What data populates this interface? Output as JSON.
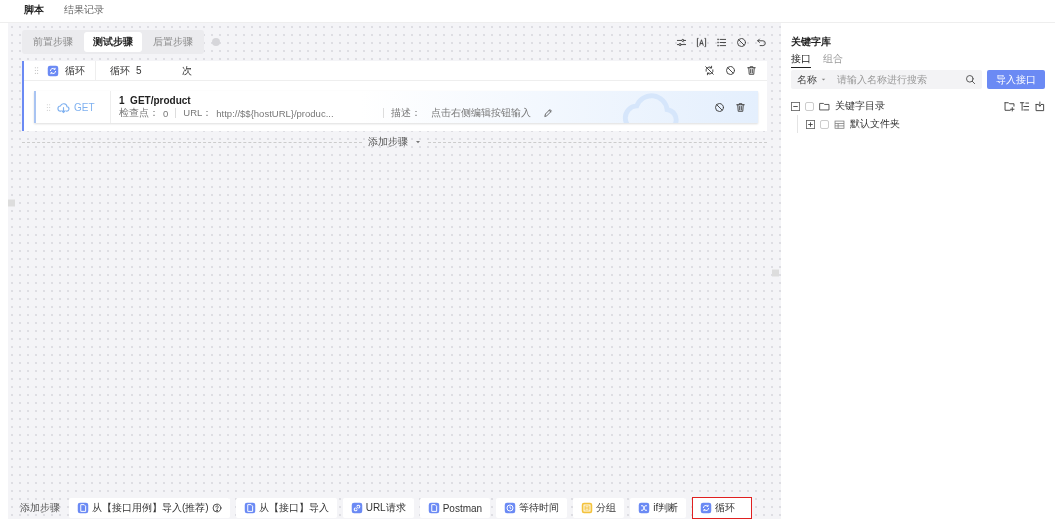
{
  "top_tabs": [
    {
      "label": "脚本",
      "selected": true
    },
    {
      "label": "结果记录",
      "selected": false
    }
  ],
  "step_tabs": [
    {
      "label": "前置步骤",
      "selected": false
    },
    {
      "label": "测试步骤",
      "selected": true
    },
    {
      "label": "后置步骤",
      "selected": false
    }
  ],
  "loop": {
    "title": "循环",
    "label": "循环",
    "count": "5",
    "unit": "次"
  },
  "step": {
    "method": "GET",
    "number": "1",
    "name": "GET/product",
    "checkpoints_label": "检查点：",
    "checkpoints": "0",
    "url_label": "URL：",
    "url": "http://$${hostURL}/produc...",
    "desc_label": "描述：",
    "desc": "点击右侧编辑按钮输入"
  },
  "add_step": "添加步骤",
  "keyword_panel": {
    "title": "关键字库",
    "tabs": [
      {
        "label": "接口",
        "selected": true
      },
      {
        "label": "组合",
        "selected": false
      }
    ],
    "filter": "名称",
    "search_placeholder": "请输入名称进行搜索",
    "import_button": "导入接口",
    "tree": [
      {
        "label": "关键字目录",
        "kind": "folder",
        "expanded": true,
        "checked": false,
        "children": [
          {
            "label": "默认文件夹",
            "kind": "table",
            "expanded": false,
            "checked": false
          }
        ]
      }
    ]
  },
  "bottom_bar": {
    "label": "添加步骤",
    "buttons": [
      {
        "label": "从【接口用例】导入(推荐)",
        "kind": "doc",
        "color": "#6b8af4",
        "help": true,
        "highlighted": false
      },
      {
        "label": "从【接口】导入",
        "kind": "doc",
        "color": "#6b8af4",
        "help": false,
        "highlighted": false
      },
      {
        "label": "URL请求",
        "kind": "link",
        "color": "#6b8af4",
        "help": false,
        "highlighted": false
      },
      {
        "label": "Postman",
        "kind": "doc",
        "color": "#6b8af4",
        "help": false,
        "highlighted": false
      },
      {
        "label": "等待时间",
        "kind": "clock",
        "color": "#6b8af4",
        "help": false,
        "highlighted": false
      },
      {
        "label": "分组",
        "kind": "group",
        "color": "#f4c23c",
        "help": false,
        "highlighted": false
      },
      {
        "label": "if判断",
        "kind": "branch",
        "color": "#6b8af4",
        "help": false,
        "highlighted": false
      },
      {
        "label": "循环",
        "kind": "loop",
        "color": "#6b8af4",
        "help": false,
        "highlighted": true
      }
    ]
  }
}
